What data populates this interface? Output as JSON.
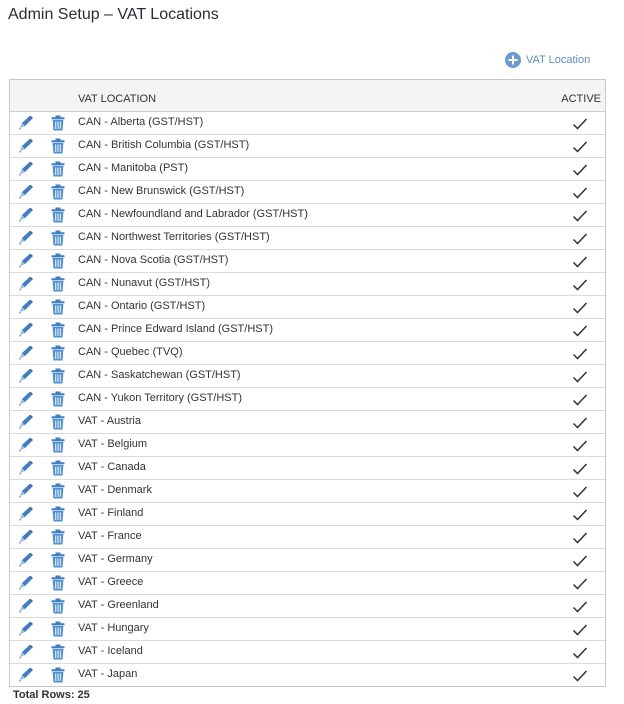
{
  "page": {
    "title": "Admin Setup – VAT Locations"
  },
  "toolbar": {
    "add_label": "VAT Location",
    "add_icon": "plus-circle-icon",
    "accent": "#5b8fc7"
  },
  "grid": {
    "columns": [
      "VAT LOCATION",
      "ACTIVE"
    ],
    "rows": [
      {
        "name": "CAN - Alberta (GST/HST)",
        "active": true
      },
      {
        "name": "CAN - British Columbia (GST/HST)",
        "active": true
      },
      {
        "name": "CAN - Manitoba (PST)",
        "active": true
      },
      {
        "name": "CAN - New Brunswick (GST/HST)",
        "active": true
      },
      {
        "name": "CAN - Newfoundland and Labrador (GST/HST)",
        "active": true
      },
      {
        "name": "CAN - Northwest Territories (GST/HST)",
        "active": true
      },
      {
        "name": "CAN - Nova Scotia (GST/HST)",
        "active": true
      },
      {
        "name": "CAN - Nunavut (GST/HST)",
        "active": true
      },
      {
        "name": "CAN - Ontario (GST/HST)",
        "active": true
      },
      {
        "name": "CAN - Prince Edward Island (GST/HST)",
        "active": true
      },
      {
        "name": "CAN - Quebec (TVQ)",
        "active": true
      },
      {
        "name": "CAN - Saskatchewan (GST/HST)",
        "active": true
      },
      {
        "name": "CAN - Yukon Territory (GST/HST)",
        "active": true
      },
      {
        "name": "VAT - Austria",
        "active": true
      },
      {
        "name": "VAT - Belgium",
        "active": true
      },
      {
        "name": "VAT - Canada",
        "active": true
      },
      {
        "name": "VAT - Denmark",
        "active": true
      },
      {
        "name": "VAT - Finland",
        "active": true
      },
      {
        "name": "VAT - France",
        "active": true
      },
      {
        "name": "VAT - Germany",
        "active": true
      },
      {
        "name": "VAT - Greece",
        "active": true
      },
      {
        "name": "VAT - Greenland",
        "active": true
      },
      {
        "name": "VAT - Hungary",
        "active": true
      },
      {
        "name": "VAT - Iceland",
        "active": true
      },
      {
        "name": "VAT - Japan",
        "active": true
      }
    ],
    "row_icons": {
      "edit": "pencil-icon",
      "delete": "trash-icon",
      "active": "checkmark-icon"
    }
  },
  "footer": {
    "total_label": "Total Rows:",
    "total_value": "25"
  }
}
